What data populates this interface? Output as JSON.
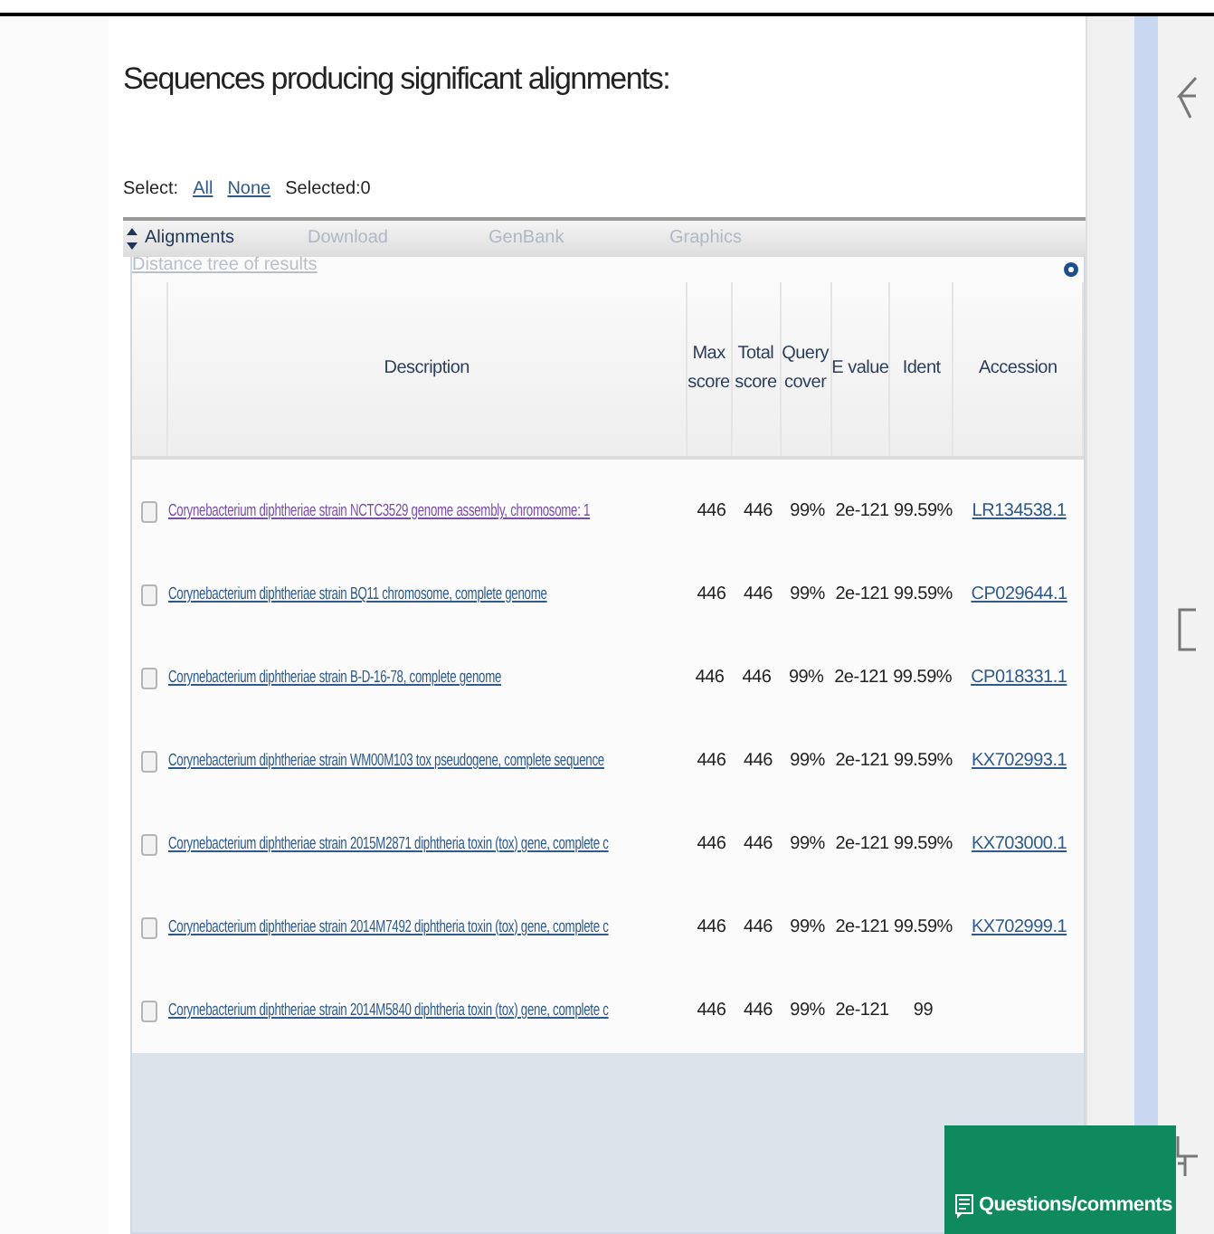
{
  "heading": "Sequences producing significant alignments:",
  "select": {
    "label": "Select:",
    "links": [
      "All",
      "None"
    ],
    "count": "Selected:0"
  },
  "toolbar": [
    {
      "label": "Alignments",
      "kind": "active"
    },
    {
      "label": "Download",
      "kind": "disabled"
    },
    {
      "label": "GenBank",
      "kind": "disabled"
    },
    {
      "label": "Graphics",
      "kind": "disabled"
    }
  ],
  "distance_tree": "Distance tree of results",
  "table": {
    "columns": [
      "Description",
      "Max score",
      "Total score",
      "Query cover",
      "E value",
      "Ident",
      "Accession"
    ],
    "rows": [
      {
        "checked": false,
        "visited": true,
        "description": "Corynebacterium diphtheriae strain NCTC3529 genome assembly, chromosome: 1",
        "max_score": "446",
        "total_score": "446",
        "query_cover": "99%",
        "e_value": "2e-121",
        "ident": "99.59%",
        "accession": "LR134538.1"
      },
      {
        "checked": false,
        "visited": false,
        "description": "Corynebacterium diphtheriae strain BQ11 chromosome, complete genome",
        "max_score": "446",
        "total_score": "446",
        "query_cover": "99%",
        "e_value": "2e-121",
        "ident": "99.59%",
        "accession": "CP029644.1"
      },
      {
        "checked": false,
        "visited": false,
        "description": "Corynebacterium diphtheriae strain B-D-16-78, complete genome",
        "max_score": "446",
        "total_score": "446",
        "query_cover": "99%",
        "e_value": "2e-121",
        "ident": "99.59%",
        "accession": "CP018331.1"
      },
      {
        "checked": false,
        "visited": false,
        "description": "Corynebacterium diphtheriae strain WM00M103 tox pseudogene, complete sequence",
        "max_score": "446",
        "total_score": "446",
        "query_cover": "99%",
        "e_value": "2e-121",
        "ident": "99.59%",
        "accession": "KX702993.1"
      },
      {
        "checked": false,
        "visited": false,
        "description": "Corynebacterium diphtheriae strain 2015M2871 diphtheria toxin (tox) gene, complete c",
        "max_score": "446",
        "total_score": "446",
        "query_cover": "99%",
        "e_value": "2e-121",
        "ident": "99.59%",
        "accession": "KX703000.1"
      },
      {
        "checked": false,
        "visited": false,
        "description": "Corynebacterium diphtheriae strain 2014M7492 diphtheria toxin (tox) gene, complete c",
        "max_score": "446",
        "total_score": "446",
        "query_cover": "99%",
        "e_value": "2e-121",
        "ident": "99.59%",
        "accession": "KX702999.1"
      },
      {
        "checked": false,
        "visited": false,
        "description": "Corynebacterium diphtheriae strain 2014M5840 diphtheria toxin (tox) gene, complete c",
        "max_score": "446",
        "total_score": "446",
        "query_cover": "99%",
        "e_value": "2e-121",
        "ident": "99",
        "accession": ""
      }
    ]
  },
  "feedback_button": "Questions/comments"
}
